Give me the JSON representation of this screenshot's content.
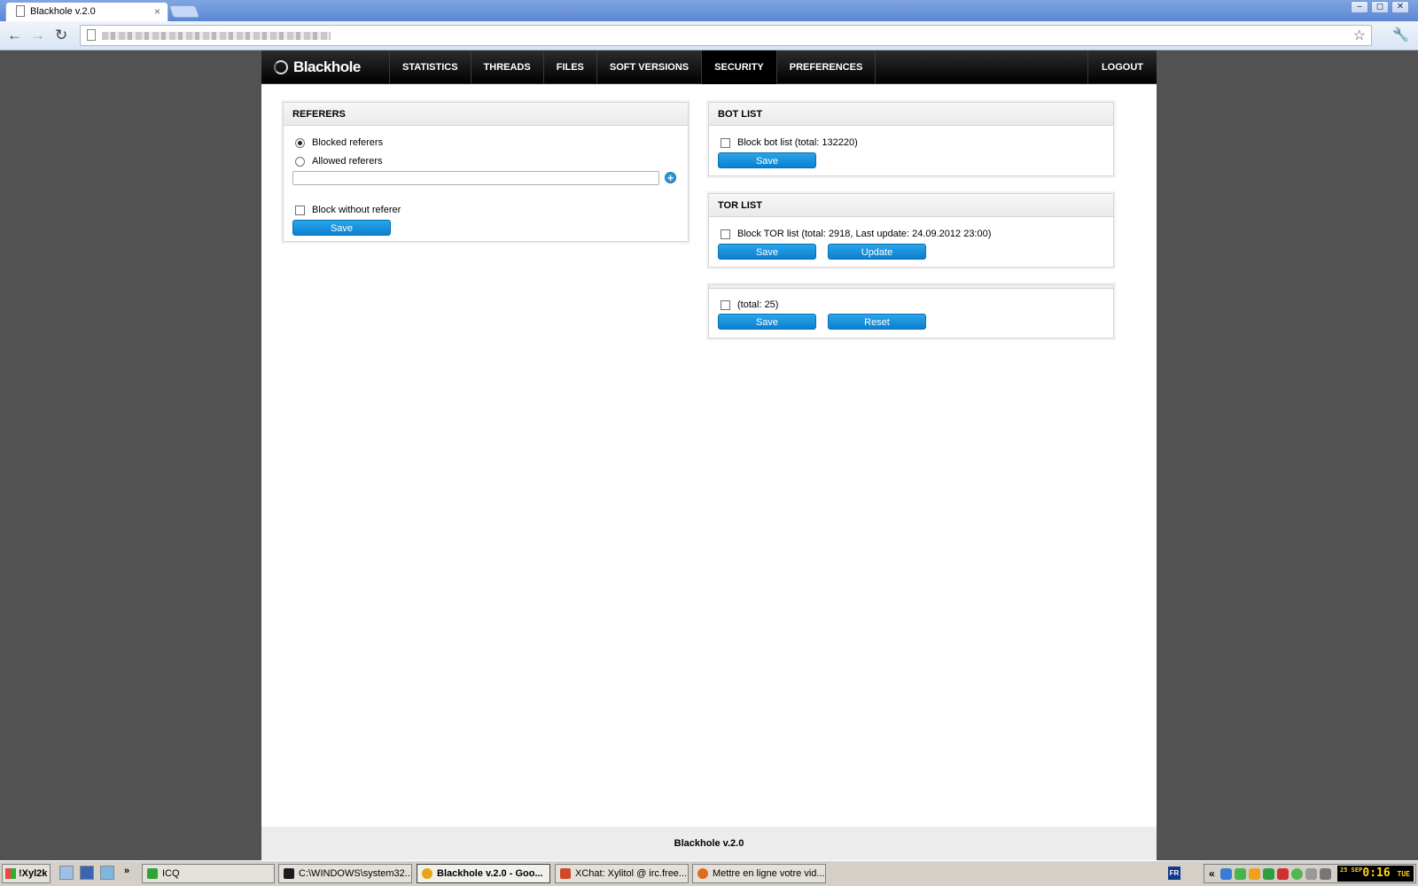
{
  "browser": {
    "tab_title": "Blackhole v.2.0",
    "tab_close": "×",
    "window_buttons": [
      "–",
      "◻",
      "✕"
    ],
    "nav_icons": [
      "back-arrow-icon",
      "forward-arrow-icon",
      "reload-icon",
      "star-icon",
      "wrench-icon"
    ]
  },
  "app": {
    "logo": "Blackhole",
    "menu": [
      "STATISTICS",
      "THREADS",
      "FILES",
      "SOFT VERSIONS",
      "SECURITY",
      "PREFERENCES"
    ],
    "active_menu": "SECURITY",
    "logout": "LOGOUT",
    "footer": "Blackhole v.2.0"
  },
  "referers": {
    "title": "REFERERS",
    "radio_blocked": "Blocked referers",
    "radio_allowed": "Allowed referers",
    "selected": "Blocked referers",
    "input_value": "",
    "block_without": "Block without referer",
    "save": "Save"
  },
  "bot_list": {
    "title": "BOT LIST",
    "checkbox": "Block bot list (total: 132220)",
    "save": "Save"
  },
  "tor_list": {
    "title": "TOR LIST",
    "checkbox": "Block TOR list (total: 2918, Last update: 24.09.2012 23:00)",
    "save": "Save",
    "update": "Update"
  },
  "third_panel": {
    "checkbox": "(total: 25)",
    "save": "Save",
    "reset": "Reset"
  },
  "taskbar": {
    "start": "!Xyl2k",
    "quick_more": "»",
    "tasks": [
      {
        "label": "ICQ",
        "color": "#2fa336"
      },
      {
        "label": "C:\\WINDOWS\\system32...",
        "color": "#1b1b1b"
      },
      {
        "label": "Blackhole v.2.0 - Goo...",
        "color": "#e8a417"
      },
      {
        "label": "XChat: Xylitol @ irc.free...",
        "color": "#d04a2a"
      },
      {
        "label": "Mettre en ligne votre vid...",
        "color": "#e06b1c"
      }
    ],
    "lang": "FR",
    "tray_chevron": "«",
    "clock_time": "0:16",
    "clock_day": "TUE",
    "clock_date": "25 SEP"
  },
  "colors": {
    "accent_button": "#1592dd",
    "nav_bar": "#111111",
    "desktop": "#525252"
  }
}
